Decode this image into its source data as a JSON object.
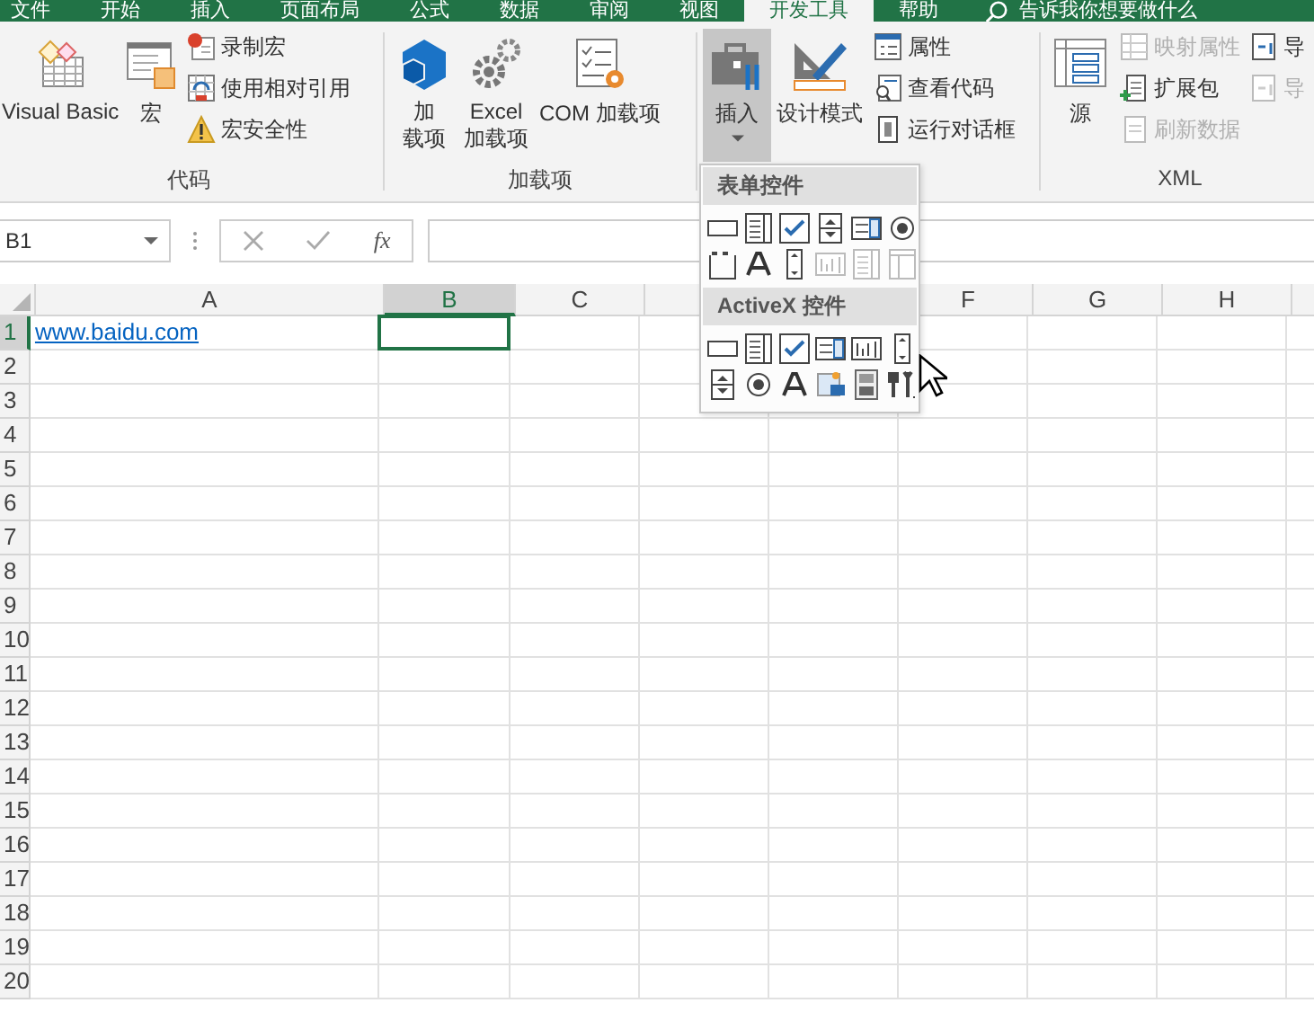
{
  "ribbon_tabs": [
    {
      "label": "文件",
      "selected": false
    },
    {
      "label": "开始",
      "selected": false
    },
    {
      "label": "插入",
      "selected": false
    },
    {
      "label": "页面布局",
      "selected": false
    },
    {
      "label": "公式",
      "selected": false
    },
    {
      "label": "数据",
      "selected": false
    },
    {
      "label": "审阅",
      "selected": false
    },
    {
      "label": "视图",
      "selected": false
    },
    {
      "label": "开发工具",
      "selected": true
    },
    {
      "label": "帮助",
      "selected": false
    }
  ],
  "tell_me": "告诉我你想要做什么",
  "code_group": {
    "label": "代码",
    "visual_basic": "Visual Basic",
    "macros": "宏",
    "record_macro": "录制宏",
    "relative_refs": "使用相对引用",
    "macro_security": "宏安全性"
  },
  "addins_group": {
    "label": "加载项",
    "addins": [
      "加",
      "载项"
    ],
    "excel_addins": [
      "Excel",
      "加载项"
    ],
    "com_addins": "COM 加载项"
  },
  "controls_group": {
    "insert": {
      "label": "插入",
      "pressed": true
    },
    "design_mode": "设计模式",
    "properties": "属性",
    "view_code": "查看代码",
    "run_dialog": "运行对话框"
  },
  "xml_group": {
    "label": "XML",
    "source": "源",
    "map_properties": {
      "label": "映射属性",
      "disabled": true
    },
    "expansion_packs": {
      "label": "扩展包",
      "disabled": false
    },
    "refresh_data": {
      "label": "刷新数据",
      "disabled": true
    },
    "import": {
      "label": "导",
      "disabled": false
    },
    "export": {
      "label": "导",
      "disabled": true
    }
  },
  "insert_menu": {
    "sections": [
      {
        "title": "表单控件"
      },
      {
        "title": "ActiveX 控件"
      }
    ]
  },
  "formula_bar": {
    "name_box": "B1",
    "function_label": "fx"
  },
  "sheet": {
    "columns": [
      {
        "label": "A",
        "selected": false
      },
      {
        "label": "B",
        "selected": true
      },
      {
        "label": "C",
        "selected": false
      },
      {
        "selected": false
      },
      {},
      {
        "label": "F",
        "selected": false
      },
      {
        "label": "G",
        "selected": false
      },
      {
        "label": "H",
        "selected": false
      },
      {
        "selected": false
      }
    ],
    "rows": [
      {
        "label": "1",
        "selected": true,
        "cells": [
          {
            "text": "www.baidu.com",
            "kind": "link"
          }
        ]
      },
      {
        "label": "2",
        "selected": false
      },
      {
        "label": "3",
        "selected": false
      },
      {
        "label": "4",
        "selected": false
      },
      {
        "label": "5",
        "selected": false
      },
      {
        "label": "6",
        "selected": false
      },
      {
        "label": "7",
        "selected": false
      },
      {
        "label": "8",
        "selected": false
      },
      {
        "label": "9",
        "selected": false
      },
      {
        "label": "10",
        "selected": false
      },
      {
        "label": "11",
        "selected": false
      },
      {
        "label": "12",
        "selected": false
      },
      {
        "label": "13",
        "selected": false
      },
      {
        "label": "14",
        "selected": false
      },
      {
        "label": "15",
        "selected": false
      },
      {
        "label": "16",
        "selected": false
      },
      {
        "label": "17",
        "selected": false
      },
      {
        "label": "18",
        "selected": false
      },
      {
        "label": "19",
        "selected": false
      },
      {
        "label": "20",
        "selected": false
      }
    ]
  }
}
